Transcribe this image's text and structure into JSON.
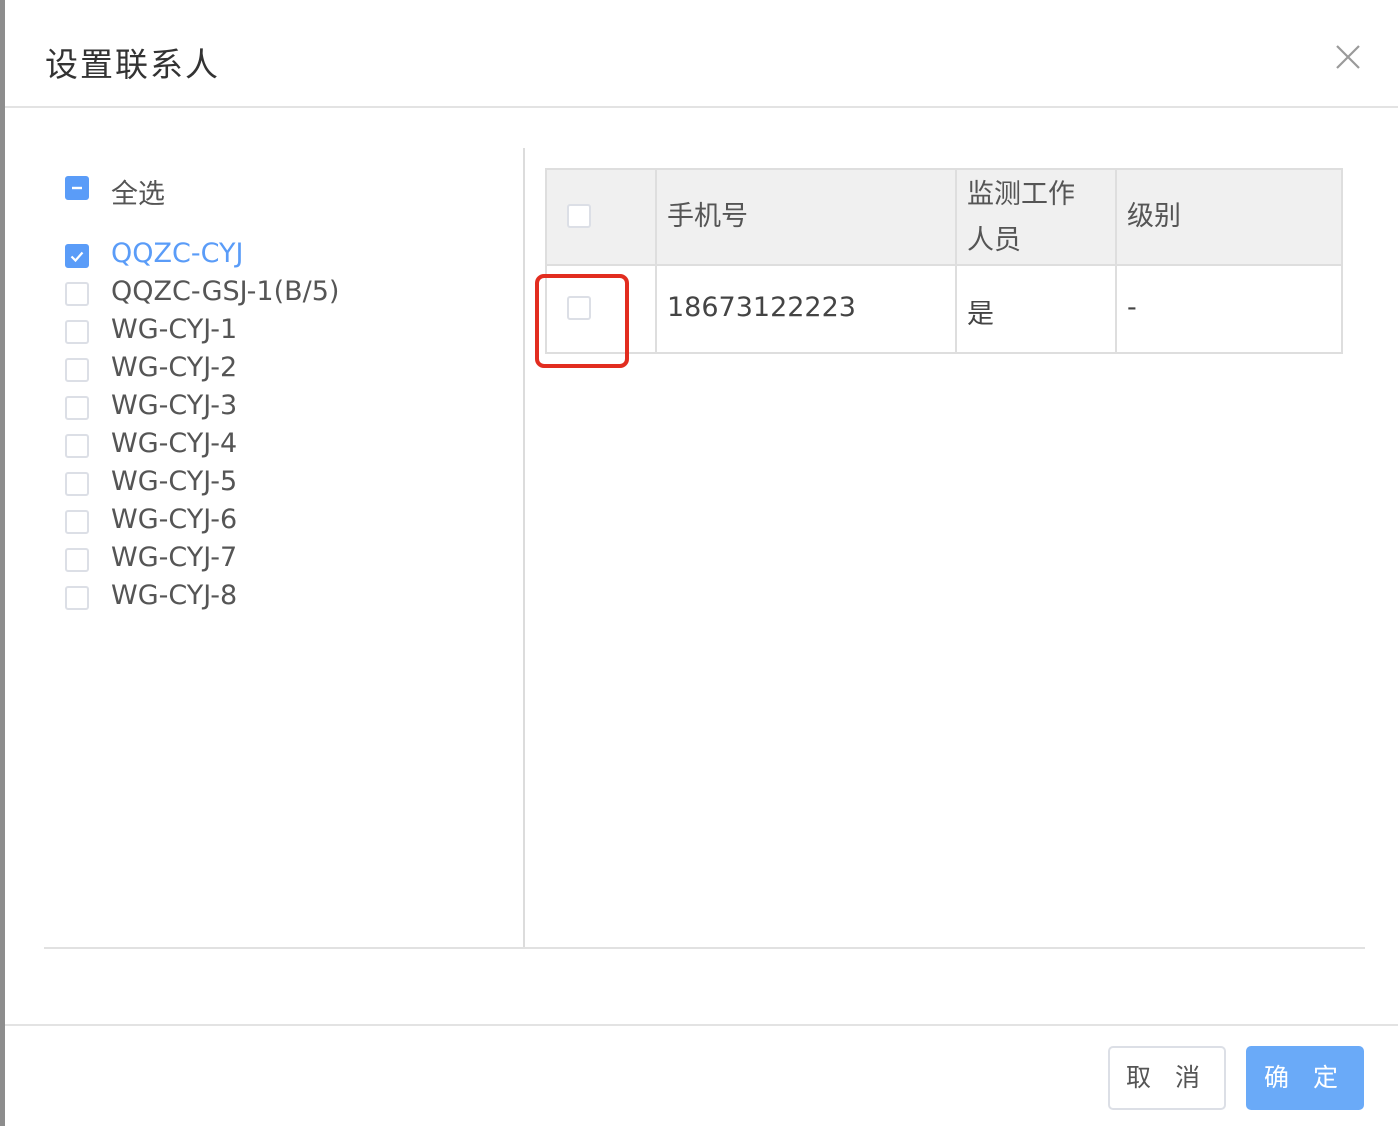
{
  "dialog": {
    "title": "设置联系人"
  },
  "left": {
    "select_all_label": "全选",
    "items": [
      {
        "label": "QQZC-CYJ",
        "checked": true
      },
      {
        "label": "QQZC-GSJ-1(B/5)",
        "checked": false
      },
      {
        "label": "WG-CYJ-1",
        "checked": false
      },
      {
        "label": "WG-CYJ-2",
        "checked": false
      },
      {
        "label": "WG-CYJ-3",
        "checked": false
      },
      {
        "label": "WG-CYJ-4",
        "checked": false
      },
      {
        "label": "WG-CYJ-5",
        "checked": false
      },
      {
        "label": "WG-CYJ-6",
        "checked": false
      },
      {
        "label": "WG-CYJ-7",
        "checked": false
      },
      {
        "label": "WG-CYJ-8",
        "checked": false
      }
    ]
  },
  "table": {
    "headers": {
      "phone": "手机号",
      "monitor_line1": "监测工作",
      "monitor_line2": "人员",
      "level": "级别"
    },
    "rows": [
      {
        "phone": "18673122223",
        "monitor": "是",
        "level": "-"
      }
    ]
  },
  "footer": {
    "cancel_label": "取 消",
    "ok_label": "确 定"
  },
  "colors": {
    "accent": "#5a9cf8",
    "highlight": "#e22d20",
    "primary_button": "#6aaaf8"
  }
}
